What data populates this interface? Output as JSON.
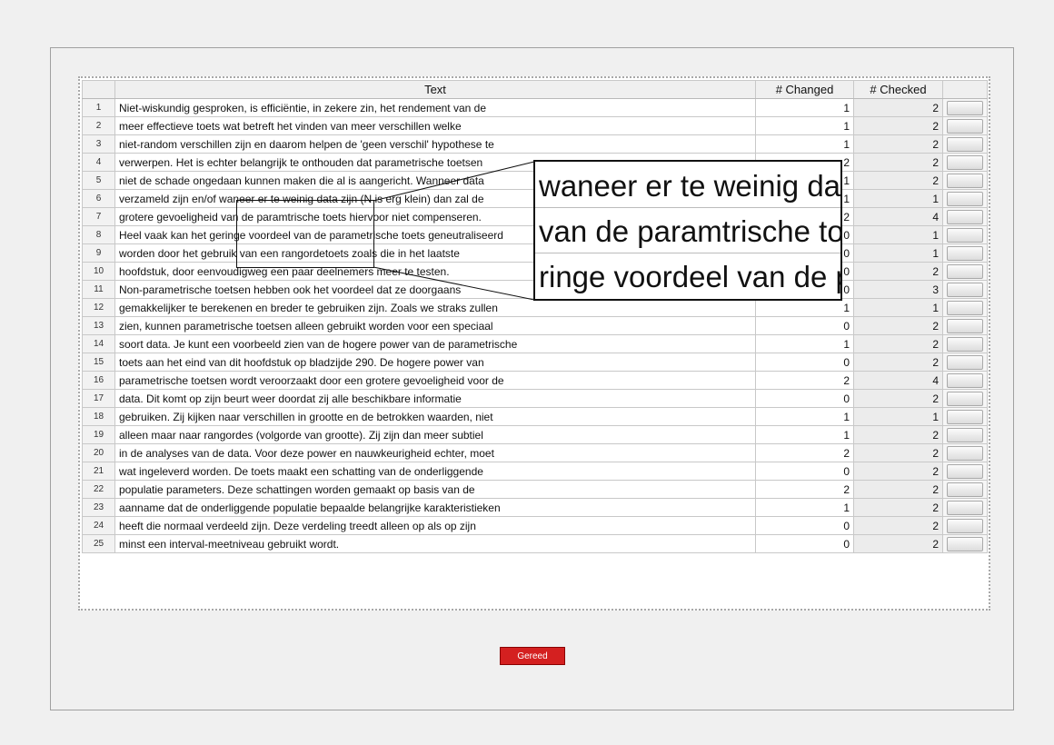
{
  "table": {
    "headers": {
      "rownum": "",
      "text": "Text",
      "changed": "# Changed",
      "checked": "# Checked",
      "action": ""
    },
    "rows": [
      {
        "n": "1",
        "text": "Niet-wiskundig gesproken, is efficiëntie, in zekere zin, het rendement van de",
        "changed": "1",
        "checked": "2"
      },
      {
        "n": "2",
        "text": "meer effectieve toets wat betreft het vinden van meer verschillen welke",
        "changed": "1",
        "checked": "2"
      },
      {
        "n": "3",
        "text": "niet-random verschillen zijn en daarom helpen de 'geen verschil' hypothese te",
        "changed": "1",
        "checked": "2"
      },
      {
        "n": "4",
        "text": "verwerpen. Het is echter belangrijk te onthouden dat parametrische toetsen",
        "changed": "2",
        "checked": "2"
      },
      {
        "n": "5",
        "text": "niet de schade ongedaan kunnen maken die al is aangericht. Wanneer data",
        "changed": "1",
        "checked": "2"
      },
      {
        "n": "6",
        "text": "verzameld zijn en/of waneer er te weinig data zijn (N is erg klein) dan zal de",
        "changed": "1",
        "checked": "1"
      },
      {
        "n": "7",
        "text": "grotere gevoeligheid van de paramtrische toets hiervoor niet compenseren.",
        "changed": "2",
        "checked": "4"
      },
      {
        "n": "8",
        "text": "Heel vaak kan het geringe voordeel van de parametrische toets geneutraliseerd",
        "changed": "0",
        "checked": "1"
      },
      {
        "n": "9",
        "text": "worden door het gebruik van een rangordetoets zoals die in het laatste",
        "changed": "0",
        "checked": "1"
      },
      {
        "n": "10",
        "text": "hoofdstuk, door eenvoudigweg een paar deelnemers meer te testen.",
        "changed": "0",
        "checked": "2"
      },
      {
        "n": "11",
        "text": "Non-parametrische toetsen hebben ook het voordeel dat ze doorgaans",
        "changed": "0",
        "checked": "3"
      },
      {
        "n": "12",
        "text": "gemakkelijker te berekenen en breder te gebruiken zijn. Zoals we straks zullen",
        "changed": "1",
        "checked": "1"
      },
      {
        "n": "13",
        "text": "zien, kunnen parametrische toetsen alleen gebruikt worden voor een speciaal",
        "changed": "0",
        "checked": "2"
      },
      {
        "n": "14",
        "text": "soort data. Je kunt een voorbeeld zien van de hogere power van de parametrische",
        "changed": "1",
        "checked": "2"
      },
      {
        "n": "15",
        "text": "toets aan het eind van dit hoofdstuk op bladzijde 290. De hogere power van",
        "changed": "0",
        "checked": "2"
      },
      {
        "n": "16",
        "text": "parametrische toetsen wordt veroorzaakt door een grotere gevoeligheid voor de",
        "changed": "2",
        "checked": "4"
      },
      {
        "n": "17",
        "text": "data. Dit komt op zijn beurt weer doordat zij alle beschikbare informatie",
        "changed": "0",
        "checked": "2"
      },
      {
        "n": "18",
        "text": "gebruiken. Zij kijken naar verschillen in grootte en de betrokken waarden, niet",
        "changed": "1",
        "checked": "1"
      },
      {
        "n": "19",
        "text": "alleen maar naar rangordes (volgorde van grootte). Zij zijn dan meer subtiel",
        "changed": "1",
        "checked": "2"
      },
      {
        "n": "20",
        "text": "in de analyses van de data. Voor deze power en nauwkeurigheid echter, moet",
        "changed": "2",
        "checked": "2"
      },
      {
        "n": "21",
        "text": "wat ingeleverd worden. De toets maakt een schatting van de onderliggende",
        "changed": "0",
        "checked": "2"
      },
      {
        "n": "22",
        "text": "populatie parameters. Deze schattingen worden gemaakt op basis van de",
        "changed": "2",
        "checked": "2"
      },
      {
        "n": "23",
        "text": "aanname dat de onderliggende populatie bepaalde belangrijke karakteristieken",
        "changed": "1",
        "checked": "2"
      },
      {
        "n": "24",
        "text": "heeft die normaal verdeeld zijn. Deze verdeling treedt alleen op als op zijn",
        "changed": "0",
        "checked": "2"
      },
      {
        "n": "25",
        "text": "minst een interval-meetniveau gebruikt wordt.",
        "changed": "0",
        "checked": "2"
      }
    ]
  },
  "zoom": {
    "lines": [
      "waneer er te weinig data",
      "van de paramtrische toet",
      "ringe voordeel van de pa"
    ]
  },
  "footer": {
    "done_label": "Gereed"
  },
  "colors": {
    "done_button": "#d42020"
  }
}
